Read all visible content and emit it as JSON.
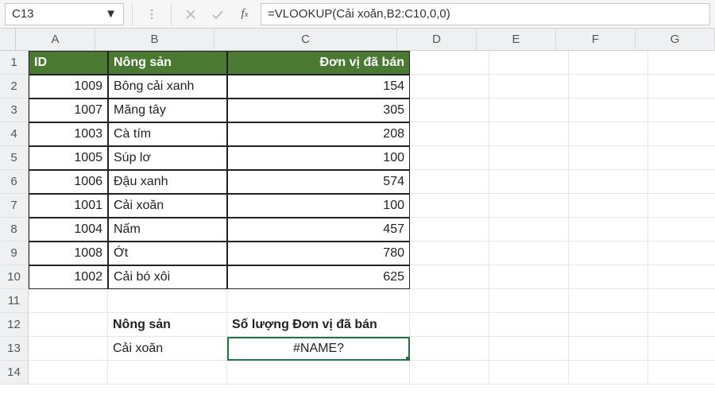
{
  "namebox": "C13",
  "formula": "=VLOOKUP(Cải xoăn,B2:C10,0,0)",
  "columns": [
    "A",
    "B",
    "C",
    "D",
    "E",
    "F",
    "G"
  ],
  "rownums": [
    1,
    2,
    3,
    4,
    5,
    6,
    7,
    8,
    9,
    10,
    11,
    12,
    13,
    14
  ],
  "header": {
    "id": "ID",
    "nongsan": "Nông sản",
    "donvi": "Đơn vị đã bán"
  },
  "rows": [
    {
      "id": 1009,
      "nongsan": "Bông cải xanh",
      "donvi": 154
    },
    {
      "id": 1007,
      "nongsan": "Măng tây",
      "donvi": 305
    },
    {
      "id": 1003,
      "nongsan": "Cà tím",
      "donvi": 208
    },
    {
      "id": 1005,
      "nongsan": "Súp lơ",
      "donvi": 100
    },
    {
      "id": 1006,
      "nongsan": "Đậu xanh",
      "donvi": 574
    },
    {
      "id": 1001,
      "nongsan": "Cải xoăn",
      "donvi": 100
    },
    {
      "id": 1004,
      "nongsan": "Nấm",
      "donvi": 457
    },
    {
      "id": 1008,
      "nongsan": "Ớt",
      "donvi": 780
    },
    {
      "id": 1002,
      "nongsan": "Cải bó xôi",
      "donvi": 625
    }
  ],
  "lookup": {
    "label_nongsan": "Nông sản",
    "label_soluong": "Số lượng Đơn vị đã bán",
    "nongsan": "Cải xoăn",
    "result": "#NAME?"
  },
  "chart_data": {
    "type": "table",
    "title": "Nông sản / Đơn vị đã bán",
    "columns": [
      "ID",
      "Nông sản",
      "Đơn vị đã bán"
    ],
    "rows": [
      [
        1009,
        "Bông cải xanh",
        154
      ],
      [
        1007,
        "Măng tây",
        305
      ],
      [
        1003,
        "Cà tím",
        208
      ],
      [
        1005,
        "Súp lơ",
        100
      ],
      [
        1006,
        "Đậu xanh",
        574
      ],
      [
        1001,
        "Cải xoăn",
        100
      ],
      [
        1004,
        "Nấm",
        457
      ],
      [
        1008,
        "Ớt",
        780
      ],
      [
        1002,
        "Cải bó xôi",
        625
      ]
    ]
  }
}
